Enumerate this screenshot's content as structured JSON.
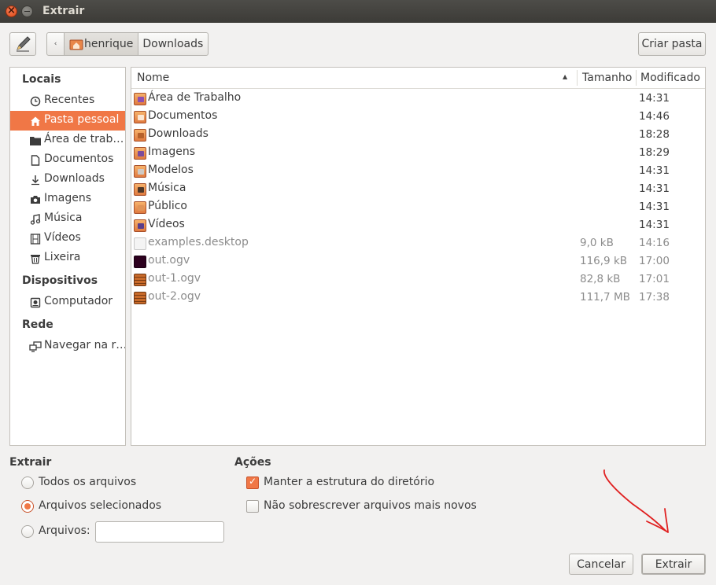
{
  "window": {
    "title": "Extrair"
  },
  "toolbar": {
    "path": [
      "henrique",
      "Downloads"
    ],
    "create_folder_label": "Criar pasta"
  },
  "sidebar": {
    "sections": [
      {
        "title": "Locais"
      },
      {
        "title": "Dispositivos"
      },
      {
        "title": "Rede"
      }
    ],
    "items": [
      {
        "label": "Recentes",
        "icon": "clock-icon"
      },
      {
        "label": "Pasta pessoal",
        "icon": "home-icon",
        "selected": true
      },
      {
        "label": "Área de trab…",
        "icon": "desktop-folder-icon"
      },
      {
        "label": "Documentos",
        "icon": "document-icon"
      },
      {
        "label": "Downloads",
        "icon": "download-icon"
      },
      {
        "label": "Imagens",
        "icon": "camera-icon"
      },
      {
        "label": "Música",
        "icon": "music-icon"
      },
      {
        "label": "Vídeos",
        "icon": "film-icon"
      },
      {
        "label": "Lixeira",
        "icon": "trash-icon"
      },
      {
        "label": "Computador",
        "icon": "drive-icon"
      },
      {
        "label": "Navegar na r…",
        "icon": "network-icon"
      }
    ]
  },
  "filelist": {
    "columns": {
      "name": "Nome",
      "size": "Tamanho",
      "modified": "Modificado"
    },
    "rows": [
      {
        "name": "Área de Trabalho",
        "size": "",
        "modified": "14:31",
        "type": "folder",
        "icon": "desk"
      },
      {
        "name": "Documentos",
        "size": "",
        "modified": "14:46",
        "type": "folder",
        "icon": ""
      },
      {
        "name": "Downloads",
        "size": "",
        "modified": "18:28",
        "type": "folder",
        "icon": "down"
      },
      {
        "name": "Imagens",
        "size": "",
        "modified": "18:29",
        "type": "folder",
        "icon": "img"
      },
      {
        "name": "Modelos",
        "size": "",
        "modified": "14:31",
        "type": "folder",
        "icon": "tpl"
      },
      {
        "name": "Música",
        "size": "",
        "modified": "14:31",
        "type": "folder",
        "icon": "mus"
      },
      {
        "name": "Público",
        "size": "",
        "modified": "14:31",
        "type": "folder",
        "icon": "pub"
      },
      {
        "name": "Vídeos",
        "size": "",
        "modified": "14:31",
        "type": "folder",
        "icon": "vid"
      },
      {
        "name": "examples.desktop",
        "size": "9,0 kB",
        "modified": "14:16",
        "type": "file",
        "icon": "doc"
      },
      {
        "name": "out.ogv",
        "size": "116,9 kB",
        "modified": "17:00",
        "type": "file",
        "icon": "vid-dark"
      },
      {
        "name": "out-1.ogv",
        "size": "82,8 kB",
        "modified": "17:01",
        "type": "file",
        "icon": "film"
      },
      {
        "name": "out-2.ogv",
        "size": "111,7 MB",
        "modified": "17:38",
        "type": "file",
        "icon": "film"
      }
    ]
  },
  "extract": {
    "title": "Extrair",
    "all_files": "Todos os arquivos",
    "selected_files": "Arquivos selecionados",
    "files_label": "Arquivos:",
    "files_value": "",
    "selected": "selected_files"
  },
  "actions": {
    "title": "Ações",
    "keep_structure": "Manter a estrutura do diretório",
    "keep_structure_checked": true,
    "no_overwrite": "Não sobrescrever arquivos mais novos",
    "no_overwrite_checked": false
  },
  "buttons": {
    "cancel": "Cancelar",
    "extract": "Extrair"
  },
  "colors": {
    "accent": "#f07746",
    "titlebar": "#3c3b37",
    "annotation": "#e02020"
  }
}
